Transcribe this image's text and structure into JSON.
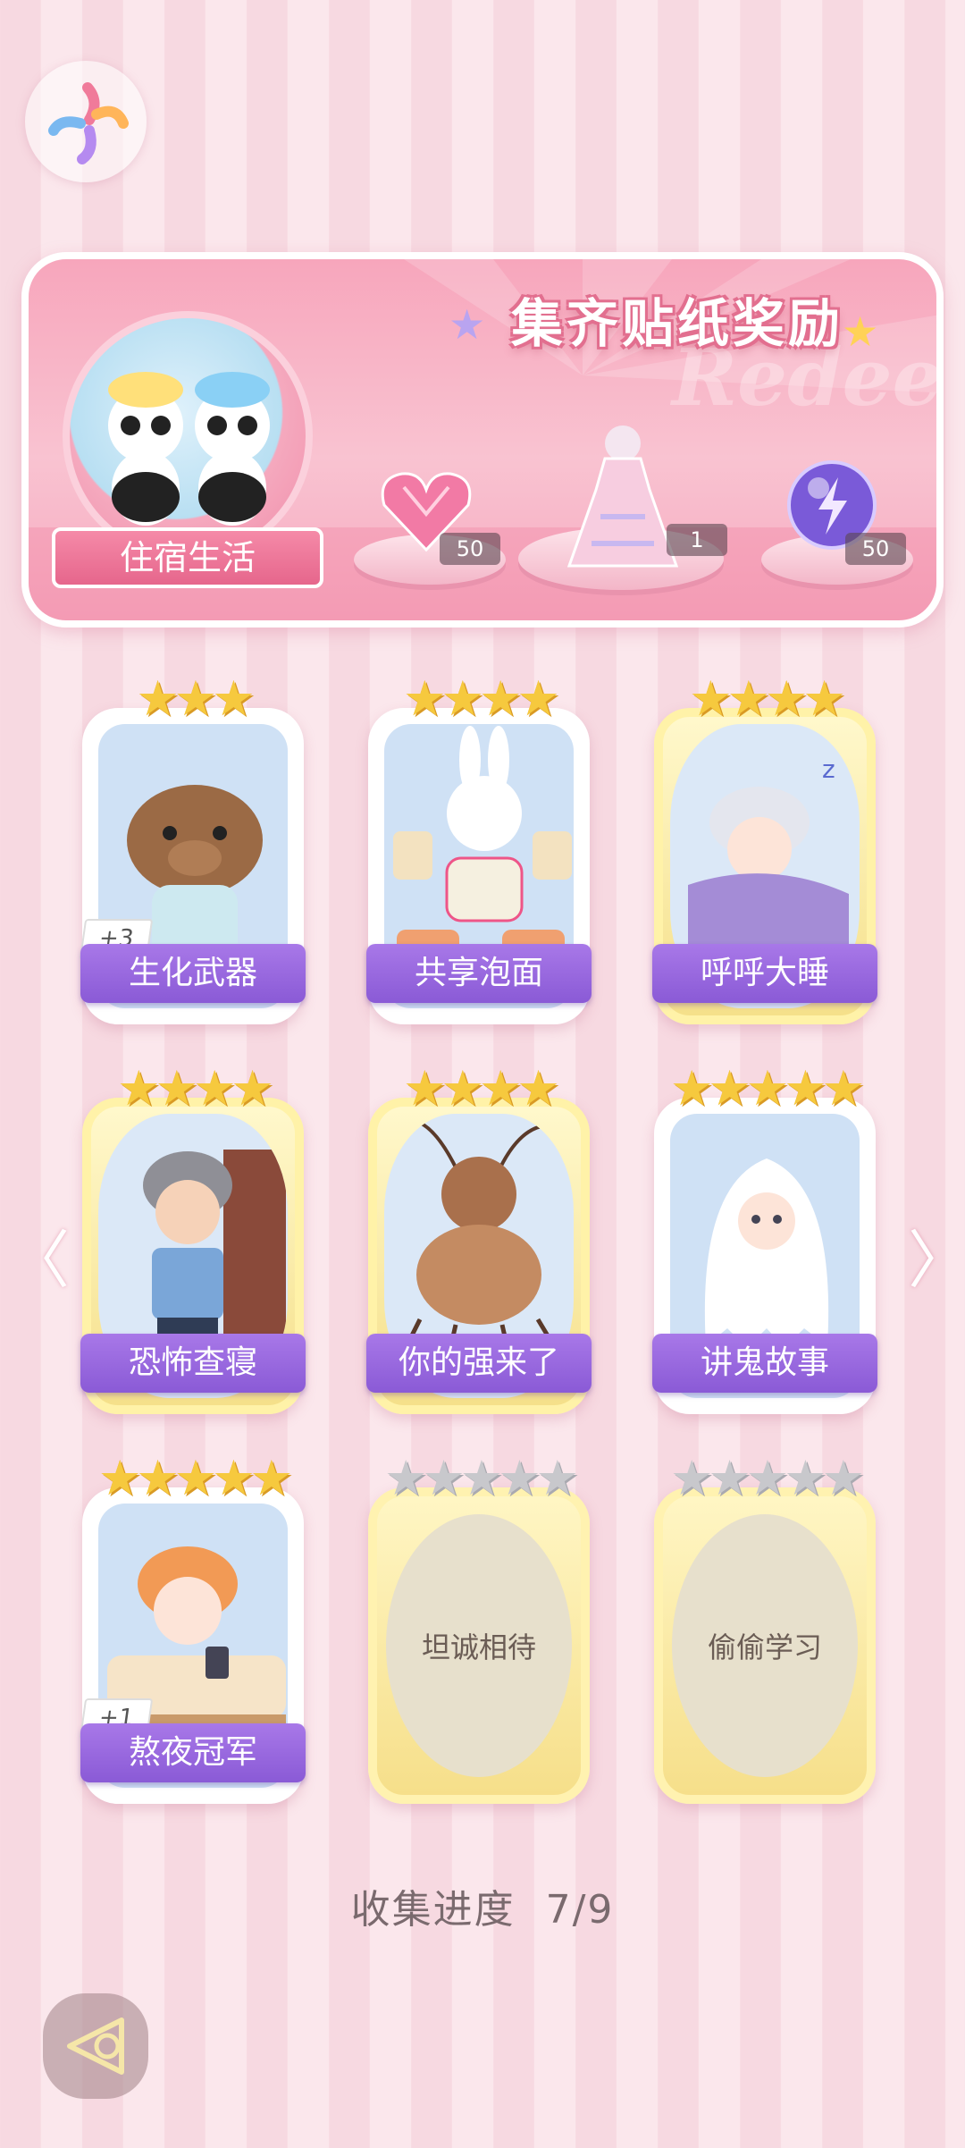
{
  "banner": {
    "title": "集齐贴纸奖励",
    "watermark": "Redeem",
    "theme_label": "住宿生活",
    "rewards": [
      {
        "icon": "pink-heart-gem-icon",
        "count": "50"
      },
      {
        "icon": "dress-outfit-icon",
        "count": "1"
      },
      {
        "icon": "lightning-orb-icon",
        "count": "50"
      }
    ]
  },
  "stickers": [
    {
      "label": "生化武器",
      "stars": "★★★",
      "badge": "+3",
      "locked": false,
      "art": "capybara-pajamas"
    },
    {
      "label": "共享泡面",
      "stars": "★★★★",
      "badge": "",
      "locked": false,
      "art": "bunny-noodles"
    },
    {
      "label": "呼呼大睡",
      "stars": "★★★★",
      "badge": "",
      "locked": false,
      "art": "boy-sleeping"
    },
    {
      "label": "恐怖查寝",
      "stars": "★★★★",
      "badge": "",
      "locked": false,
      "art": "dorm-auntie"
    },
    {
      "label": "你的强来了",
      "stars": "★★★★",
      "badge": "",
      "locked": false,
      "art": "cockroach"
    },
    {
      "label": "讲鬼故事",
      "stars": "★★★★★",
      "badge": "",
      "locked": false,
      "art": "ghost-boy"
    },
    {
      "label": "熬夜冠军",
      "stars": "★★★★★",
      "badge": "+1",
      "locked": false,
      "art": "boy-phone-bed"
    },
    {
      "label": "坦诚相待",
      "stars": "★★★★★",
      "badge": "",
      "locked": true,
      "art": ""
    },
    {
      "label": "偷偷学习",
      "stars": "★★★★★",
      "badge": "",
      "locked": true,
      "art": ""
    }
  ],
  "progress": {
    "label": "收集进度",
    "value": "7/9"
  },
  "nav": {
    "prev": "〈",
    "next": "〉"
  },
  "colors": {
    "card_label": "#9a6ae0",
    "star": "#f6c93e",
    "banner": "#f7a6bc"
  }
}
